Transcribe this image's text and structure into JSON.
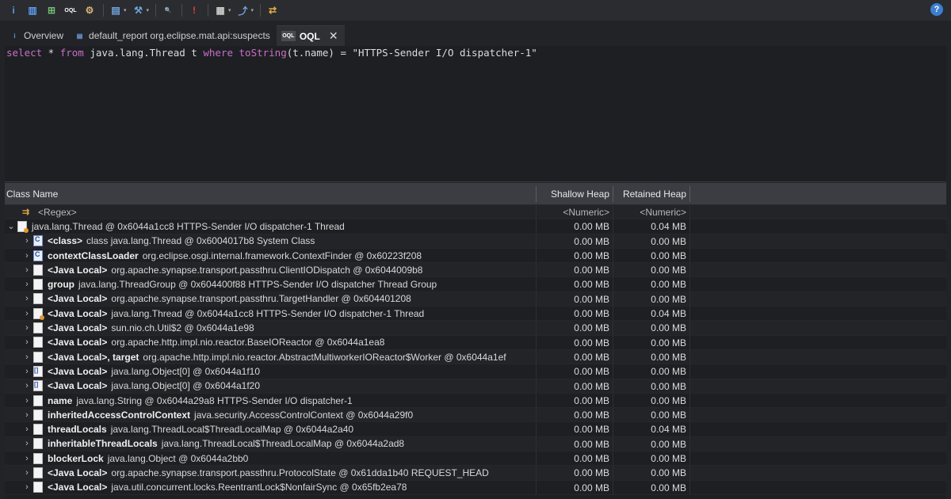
{
  "toolbar": {
    "buttons": [
      {
        "icon": "info-icon",
        "glyph": "i",
        "color": "#5b9bea"
      },
      {
        "icon": "histogram-icon",
        "glyph": "▥",
        "color": "#5b9bea"
      },
      {
        "icon": "dominator-tree-icon",
        "glyph": "⊞",
        "color": "#6fbf6f"
      },
      {
        "icon": "oql-icon",
        "glyph": "OQL",
        "color": "#ffffff"
      },
      {
        "icon": "threads-icon",
        "glyph": "⚙",
        "color": "#d8b27a"
      },
      {
        "icon": "report-icon",
        "glyph": "▤",
        "color": "#6fa3e0"
      },
      {
        "icon": "query-browser-icon",
        "glyph": "⚒",
        "color": "#6fa3e0"
      },
      {
        "icon": "search-icon",
        "glyph": "🔍",
        "color": "#dddddd"
      },
      {
        "icon": "leak-suspect-icon",
        "glyph": "!",
        "color": "#e04040"
      },
      {
        "icon": "calculator-icon",
        "glyph": "▦",
        "color": "#cccccc"
      },
      {
        "icon": "export-icon",
        "glyph": "⤴",
        "color": "#6fa3e0"
      },
      {
        "icon": "compare-icon",
        "glyph": "⇄",
        "color": "#e0b040"
      }
    ],
    "help_glyph": "?"
  },
  "tabs": [
    {
      "label": "Overview",
      "icon": "info-icon",
      "glyph": "i",
      "active": false
    },
    {
      "label": "default_report  org.eclipse.mat.api:suspects",
      "icon": "report-icon",
      "glyph": "▤",
      "active": false
    },
    {
      "label": "OQL",
      "icon": "oql-icon",
      "glyph": "OQL",
      "active": true,
      "close": "✕"
    }
  ],
  "editor": {
    "tokens": [
      {
        "t": "select",
        "k": "kw"
      },
      {
        "t": " * ",
        "k": "txt"
      },
      {
        "t": "from",
        "k": "kw"
      },
      {
        "t": " java.lang.Thread t ",
        "k": "txt"
      },
      {
        "t": "where",
        "k": "kw"
      },
      {
        "t": " ",
        "k": "txt"
      },
      {
        "t": "toString",
        "k": "fn"
      },
      {
        "t": "(t.name) = \"HTTPS-Sender I/O dispatcher-1\"",
        "k": "txt"
      }
    ]
  },
  "table": {
    "headers": {
      "name": "Class Name",
      "shallow": "Shallow Heap",
      "retained": "Retained Heap"
    },
    "filter": {
      "name": "<Regex>",
      "shallow": "<Numeric>",
      "retained": "<Numeric>"
    },
    "rows": [
      {
        "exp": "⌄",
        "indent": 0,
        "icon": "thr",
        "field": "",
        "value": "java.lang.Thread @ 0x6044a1cc8  HTTPS-Sender I/O dispatcher-1 Thread",
        "shallow": "0.00 MB",
        "retained": "0.04 MB"
      },
      {
        "exp": "›",
        "indent": 1,
        "icon": "cls",
        "field": "<class>",
        "value": "class java.lang.Thread @ 0x6004017b8  System Class",
        "shallow": "0.00 MB",
        "retained": "0.00 MB"
      },
      {
        "exp": "›",
        "indent": 1,
        "icon": "cls",
        "field": "contextClassLoader",
        "value": "org.eclipse.osgi.internal.framework.ContextFinder @ 0x60223f208",
        "shallow": "0.00 MB",
        "retained": "0.00 MB"
      },
      {
        "exp": "›",
        "indent": 1,
        "icon": "obj",
        "field": "<Java Local>",
        "value": "org.apache.synapse.transport.passthru.ClientIODispatch @ 0x6044009b8",
        "shallow": "0.00 MB",
        "retained": "0.00 MB"
      },
      {
        "exp": "›",
        "indent": 1,
        "icon": "obj",
        "field": "group",
        "value": "java.lang.ThreadGroup @ 0x604400f88  HTTPS-Sender I/O dispatcher Thread Group",
        "shallow": "0.00 MB",
        "retained": "0.00 MB"
      },
      {
        "exp": "›",
        "indent": 1,
        "icon": "obj",
        "field": "<Java Local>",
        "value": "org.apache.synapse.transport.passthru.TargetHandler @ 0x604401208",
        "shallow": "0.00 MB",
        "retained": "0.00 MB"
      },
      {
        "exp": "›",
        "indent": 1,
        "icon": "thr",
        "field": "<Java Local>",
        "value": "java.lang.Thread @ 0x6044a1cc8  HTTPS-Sender I/O dispatcher-1 Thread",
        "shallow": "0.00 MB",
        "retained": "0.04 MB"
      },
      {
        "exp": "›",
        "indent": 1,
        "icon": "obj",
        "field": "<Java Local>",
        "value": "sun.nio.ch.Util$2 @ 0x6044a1e98",
        "shallow": "0.00 MB",
        "retained": "0.00 MB"
      },
      {
        "exp": "›",
        "indent": 1,
        "icon": "obj",
        "field": "<Java Local>",
        "value": "org.apache.http.impl.nio.reactor.BaseIOReactor @ 0x6044a1ea8",
        "shallow": "0.00 MB",
        "retained": "0.00 MB"
      },
      {
        "exp": "›",
        "indent": 1,
        "icon": "obj",
        "field": "<Java Local>, target",
        "value": "org.apache.http.impl.nio.reactor.AbstractMultiworkerIOReactor$Worker @ 0x6044a1ef",
        "shallow": "0.00 MB",
        "retained": "0.00 MB"
      },
      {
        "exp": "›",
        "indent": 1,
        "icon": "arr",
        "field": "<Java Local>",
        "value": "java.lang.Object[0] @ 0x6044a1f10",
        "shallow": "0.00 MB",
        "retained": "0.00 MB"
      },
      {
        "exp": "›",
        "indent": 1,
        "icon": "arr",
        "field": "<Java Local>",
        "value": "java.lang.Object[0] @ 0x6044a1f20",
        "shallow": "0.00 MB",
        "retained": "0.00 MB"
      },
      {
        "exp": "›",
        "indent": 1,
        "icon": "obj",
        "field": "name",
        "value": "java.lang.String @ 0x6044a29a8  HTTPS-Sender I/O dispatcher-1",
        "shallow": "0.00 MB",
        "retained": "0.00 MB"
      },
      {
        "exp": "›",
        "indent": 1,
        "icon": "obj",
        "field": "inheritedAccessControlContext",
        "value": "java.security.AccessControlContext @ 0x6044a29f0",
        "shallow": "0.00 MB",
        "retained": "0.00 MB"
      },
      {
        "exp": "›",
        "indent": 1,
        "icon": "obj",
        "field": "threadLocals",
        "value": "java.lang.ThreadLocal$ThreadLocalMap @ 0x6044a2a40",
        "shallow": "0.00 MB",
        "retained": "0.04 MB"
      },
      {
        "exp": "›",
        "indent": 1,
        "icon": "obj",
        "field": "inheritableThreadLocals",
        "value": "java.lang.ThreadLocal$ThreadLocalMap @ 0x6044a2ad8",
        "shallow": "0.00 MB",
        "retained": "0.00 MB"
      },
      {
        "exp": "›",
        "indent": 1,
        "icon": "obj",
        "field": "blockerLock",
        "value": "java.lang.Object @ 0x6044a2bb0",
        "shallow": "0.00 MB",
        "retained": "0.00 MB"
      },
      {
        "exp": "›",
        "indent": 1,
        "icon": "obj",
        "field": "<Java Local>",
        "value": "org.apache.synapse.transport.passthru.ProtocolState @ 0x61dda1b40  REQUEST_HEAD",
        "shallow": "0.00 MB",
        "retained": "0.00 MB"
      },
      {
        "exp": "›",
        "indent": 1,
        "icon": "obj",
        "field": "<Java Local>",
        "value": "java.util.concurrent.locks.ReentrantLock$NonfairSync @ 0x65fb2ea78",
        "shallow": "0.00 MB",
        "retained": "0.00 MB"
      }
    ]
  }
}
